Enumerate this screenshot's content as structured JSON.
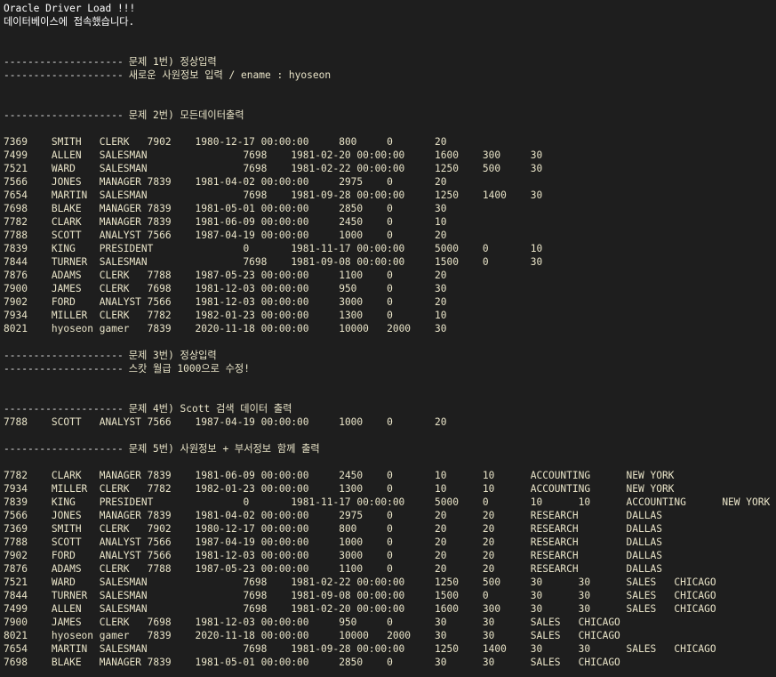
{
  "console": {
    "header": [
      "Oracle Driver Load !!!",
      "데이터베이스에 접속했습니다."
    ],
    "sections": [
      {
        "id": "problem1",
        "dashes": "--------------------",
        "lines": [
          {
            "kind": "sep",
            "text": "문제 1번) 정상입력"
          },
          {
            "kind": "sep",
            "text": "새로운 사원정보 입력 / ename : hyoseon"
          }
        ]
      },
      {
        "id": "problem2",
        "dashes": "--------------------",
        "title": "문제 2번) 모든데이터출력",
        "rows": [
          [
            "7369",
            "SMITH",
            "CLERK",
            "7902",
            "1980-12-17 00:00:00",
            "800",
            "0",
            "20"
          ],
          [
            "7499",
            "ALLEN",
            "SALESMAN",
            "",
            "7698",
            "1981-02-20 00:00:00",
            "1600",
            "300",
            "30"
          ],
          [
            "7521",
            "WARD",
            "SALESMAN",
            "",
            "7698",
            "1981-02-22 00:00:00",
            "1250",
            "500",
            "30"
          ],
          [
            "7566",
            "JONES",
            "MANAGER 7839",
            "1981-04-02 00:00:00",
            "2975",
            "0",
            "20"
          ],
          [
            "7654",
            "MARTIN",
            "SALESMAN",
            "",
            "7698",
            "1981-09-28 00:00:00",
            "1250",
            "1400",
            "30"
          ],
          [
            "7698",
            "BLAKE",
            "MANAGER 7839",
            "1981-05-01 00:00:00",
            "2850",
            "0",
            "30"
          ],
          [
            "7782",
            "CLARK",
            "MANAGER 7839",
            "1981-06-09 00:00:00",
            "2450",
            "0",
            "10"
          ],
          [
            "7788",
            "SCOTT",
            "ANALYST 7566",
            "1987-04-19 00:00:00",
            "1000",
            "0",
            "20"
          ],
          [
            "7839",
            "KING",
            "PRESIDENT",
            "",
            "0",
            "1981-11-17 00:00:00",
            "5000",
            "0",
            "10"
          ],
          [
            "7844",
            "TURNER",
            "SALESMAN",
            "",
            "7698",
            "1981-09-08 00:00:00",
            "1500",
            "0",
            "30"
          ],
          [
            "7876",
            "ADAMS",
            "CLERK",
            "7788",
            "1987-05-23 00:00:00",
            "1100",
            "0",
            "20"
          ],
          [
            "7900",
            "JAMES",
            "CLERK",
            "7698",
            "1981-12-03 00:00:00",
            "950",
            "0",
            "30"
          ],
          [
            "7902",
            "FORD",
            "ANALYST 7566",
            "1981-12-03 00:00:00",
            "3000",
            "0",
            "20"
          ],
          [
            "7934",
            "MILLER",
            "CLERK",
            "7782",
            "1982-01-23 00:00:00",
            "1300",
            "0",
            "10"
          ],
          [
            "8021",
            "hyoseon",
            "gamer",
            "7839",
            "2020-11-18 00:00:00",
            "10000",
            "2000",
            "30"
          ]
        ]
      },
      {
        "id": "problem3",
        "dashes": "--------------------",
        "lines": [
          {
            "kind": "sep",
            "text": "문제 3번) 정상입력"
          },
          {
            "kind": "sep",
            "text": "스캇 월급 1000으로 수정!"
          }
        ]
      },
      {
        "id": "problem4",
        "dashes": "--------------------",
        "title": "문제 4번) Scott 검색 데이터 출력",
        "rows": [
          [
            "7788",
            "SCOTT",
            "ANALYST 7566",
            "1987-04-19 00:00:00",
            "1000",
            "0",
            "20"
          ]
        ]
      },
      {
        "id": "problem5",
        "dashes": "--------------------",
        "title": "문제 5번) 사원정보 + 부서정보 함께 출력",
        "rows": [
          [
            "7782",
            "CLARK",
            "MANAGER 7839",
            "1981-06-09 00:00:00",
            "2450",
            "0",
            "10",
            "10",
            "ACCOUNTING",
            "NEW YORK"
          ],
          [
            "7934",
            "MILLER",
            "CLERK",
            "7782",
            "1982-01-23 00:00:00",
            "1300",
            "0",
            "10",
            "10",
            "ACCOUNTING",
            "NEW YORK"
          ],
          [
            "7839",
            "KING",
            "PRESIDENT",
            "",
            "0",
            "1981-11-17 00:00:00",
            "5000",
            "0",
            "10",
            "10",
            "ACCOUNTING",
            "NEW YORK"
          ],
          [
            "7566",
            "JONES",
            "MANAGER 7839",
            "1981-04-02 00:00:00",
            "2975",
            "0",
            "20",
            "20",
            "RESEARCH",
            "DALLAS"
          ],
          [
            "7369",
            "SMITH",
            "CLERK",
            "7902",
            "1980-12-17 00:00:00",
            "800",
            "0",
            "20",
            "20",
            "RESEARCH",
            "DALLAS"
          ],
          [
            "7788",
            "SCOTT",
            "ANALYST 7566",
            "1987-04-19 00:00:00",
            "1000",
            "0",
            "20",
            "20",
            "RESEARCH",
            "DALLAS"
          ],
          [
            "7902",
            "FORD",
            "ANALYST 7566",
            "1981-12-03 00:00:00",
            "3000",
            "0",
            "20",
            "20",
            "RESEARCH",
            "DALLAS"
          ],
          [
            "7876",
            "ADAMS",
            "CLERK",
            "7788",
            "1987-05-23 00:00:00",
            "1100",
            "0",
            "20",
            "20",
            "RESEARCH",
            "DALLAS"
          ],
          [
            "7521",
            "WARD",
            "SALESMAN",
            "",
            "7698",
            "1981-02-22 00:00:00",
            "1250",
            "500",
            "30",
            "30",
            "SALES",
            "CHICAGO"
          ],
          [
            "7844",
            "TURNER",
            "SALESMAN",
            "",
            "7698",
            "1981-09-08 00:00:00",
            "1500",
            "0",
            "30",
            "30",
            "SALES",
            "CHICAGO"
          ],
          [
            "7499",
            "ALLEN",
            "SALESMAN",
            "",
            "7698",
            "1981-02-20 00:00:00",
            "1600",
            "300",
            "30",
            "30",
            "SALES",
            "CHICAGO"
          ],
          [
            "7900",
            "JAMES",
            "CLERK",
            "7698",
            "1981-12-03 00:00:00",
            "950",
            "0",
            "30",
            "30",
            "SALES",
            "CHICAGO"
          ],
          [
            "8021",
            "hyoseon",
            "gamer",
            "7839",
            "2020-11-18 00:00:00",
            "10000",
            "2000",
            "30",
            "30",
            "SALES",
            "CHICAGO"
          ],
          [
            "7654",
            "MARTIN",
            "SALESMAN",
            "",
            "7698",
            "1981-09-28 00:00:00",
            "1250",
            "1400",
            "30",
            "30",
            "SALES",
            "CHICAGO"
          ],
          [
            "7698",
            "BLAKE",
            "MANAGER 7839",
            "1981-05-01 00:00:00",
            "2850",
            "0",
            "30",
            "30",
            "SALES",
            "CHICAGO"
          ]
        ]
      }
    ]
  }
}
